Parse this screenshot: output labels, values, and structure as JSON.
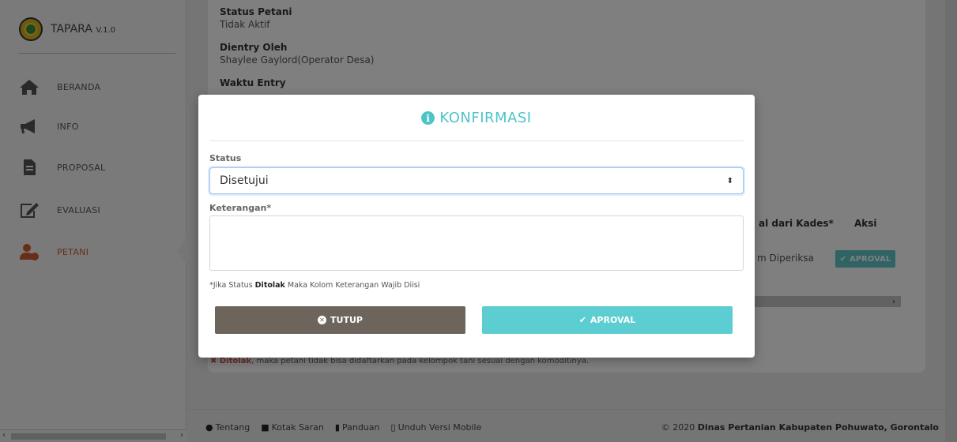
{
  "sidebar": {
    "brand": {
      "name": "TAPARA",
      "version": "V.1.0"
    },
    "items": [
      {
        "label": "BERANDA"
      },
      {
        "label": "INFO"
      },
      {
        "label": "PROPOSAL"
      },
      {
        "label": "EVALUASI"
      },
      {
        "label": "PETANI"
      }
    ]
  },
  "detail": {
    "status_label": "Status Petani",
    "status_value": "Tidak Aktif",
    "entered_by_label": "Dientry Oleh",
    "entered_by_value": "Shaylee Gaylord(Operator Desa)",
    "entry_time_label": "Waktu Entry"
  },
  "table": {
    "col_approval": "al dari Kades*",
    "col_action": "Aksi",
    "row_status": "m Diperiksa",
    "row_button": "APROVAL"
  },
  "note": {
    "prefix": "Ditolak",
    "text": ", maka petani tidak bisa didaftarkan pada kelompok tani sesuai dengan komoditinya."
  },
  "footer": {
    "links": [
      "Tentang",
      "Kotak Saran",
      "Panduan",
      "Unduh Versi Mobile"
    ],
    "copy_prefix": "© 2020 ",
    "copy_org": "Dinas Pertanian Kabupaten Pohuwato, Gorontalo"
  },
  "modal": {
    "title": "KONFIRMASI",
    "status_label": "Status",
    "status_value": "Disetujui",
    "keterangan_label": "Keterangan*",
    "hint_pre": "*Jika Status ",
    "hint_bold": "Ditolak",
    "hint_post": " Maka Kolom Keterangan Wajib Diisi",
    "close_label": "TUTUP",
    "approve_label": "APROVAL"
  },
  "colors": {
    "accent": "#4ec4c9",
    "close": "#6d645c",
    "active_nav": "#d35d2f"
  },
  "icons": [
    "home-icon",
    "megaphone-icon",
    "document-icon",
    "edit-icon",
    "users-icon",
    "info-icon",
    "times-circle-icon",
    "check-icon"
  ]
}
